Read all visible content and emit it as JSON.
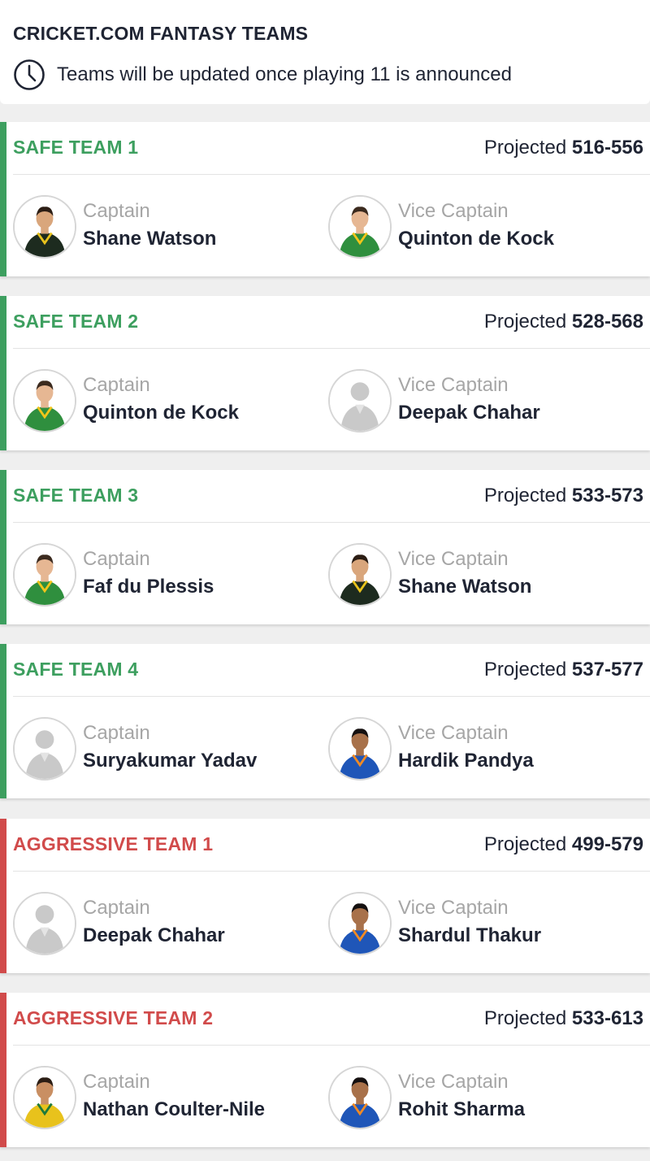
{
  "header": {
    "title": "CRICKET.COM FANTASY TEAMS",
    "note": "Teams will be updated once playing 11 is announced",
    "note_icon": "clock-icon"
  },
  "labels": {
    "projected": "Projected",
    "captain": "Captain",
    "vice_captain": "Vice Captain"
  },
  "colors": {
    "safe": "#3d9f5f",
    "aggressive": "#d14b4b",
    "text_dark": "#1f2433",
    "text_muted": "#a6a6a6"
  },
  "teams": [
    {
      "name": "SAFE TEAM 1",
      "type": "safe",
      "projected": "516-556",
      "captain": {
        "name": "Shane Watson",
        "kit": "australia-dark"
      },
      "vice_captain": {
        "name": "Quinton de Kock",
        "kit": "south-africa"
      }
    },
    {
      "name": "SAFE TEAM 2",
      "type": "safe",
      "projected": "528-568",
      "captain": {
        "name": "Quinton de Kock",
        "kit": "south-africa"
      },
      "vice_captain": {
        "name": "Deepak Chahar",
        "kit": "placeholder"
      }
    },
    {
      "name": "SAFE TEAM 3",
      "type": "safe",
      "projected": "533-573",
      "captain": {
        "name": "Faf du Plessis",
        "kit": "south-africa"
      },
      "vice_captain": {
        "name": "Shane Watson",
        "kit": "australia-dark"
      }
    },
    {
      "name": "SAFE TEAM 4",
      "type": "safe",
      "projected": "537-577",
      "captain": {
        "name": "Suryakumar Yadav",
        "kit": "placeholder"
      },
      "vice_captain": {
        "name": "Hardik Pandya",
        "kit": "india"
      }
    },
    {
      "name": "AGGRESSIVE TEAM 1",
      "type": "aggressive",
      "projected": "499-579",
      "captain": {
        "name": "Deepak Chahar",
        "kit": "placeholder"
      },
      "vice_captain": {
        "name": "Shardul Thakur",
        "kit": "india"
      }
    },
    {
      "name": "AGGRESSIVE TEAM 2",
      "type": "aggressive",
      "projected": "533-613",
      "captain": {
        "name": "Nathan Coulter-Nile",
        "kit": "australia"
      },
      "vice_captain": {
        "name": "Rohit Sharma",
        "kit": "india"
      }
    }
  ]
}
